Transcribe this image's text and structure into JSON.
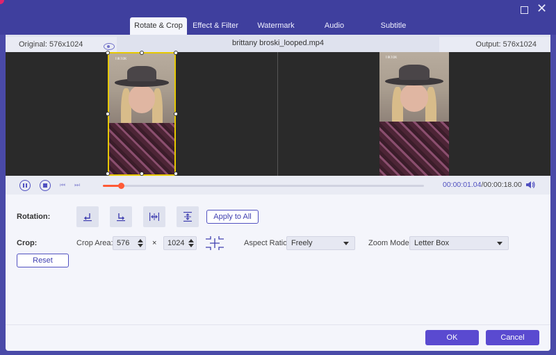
{
  "window": {
    "tabs": [
      {
        "label": "Rotate & Crop",
        "active": true
      },
      {
        "label": "Effect & Filter",
        "active": false
      },
      {
        "label": "Watermark",
        "active": false
      },
      {
        "label": "Audio",
        "active": false
      },
      {
        "label": "Subtitle",
        "active": false
      }
    ],
    "controls": {
      "maximize_icon": "maximize-icon",
      "close_icon": "close-icon"
    }
  },
  "infobar": {
    "original": "Original: 576x1024",
    "filename": "brittany broski_looped.mp4",
    "output": "Output: 576x1024"
  },
  "preview": {
    "watermark_text": "TikTok"
  },
  "playback": {
    "progress": 0.058,
    "current_time": "00:00:01.04",
    "separator": "/",
    "duration": "00:00:18.00",
    "accent_color": "#5050c0",
    "progress_color": "#ff5a36"
  },
  "rotation": {
    "label": "Rotation:",
    "buttons": [
      "rotate-left-icon",
      "rotate-right-icon",
      "flip-horizontal-icon",
      "flip-vertical-icon"
    ],
    "apply_all": "Apply to All"
  },
  "crop": {
    "label": "Crop:",
    "area_label": "Crop Area:",
    "width": "576",
    "times": "×",
    "height": "1024",
    "reset": "Reset",
    "aspect_label": "Aspect Ratio:",
    "aspect_value": "Freely",
    "zoom_label": "Zoom Mode:",
    "zoom_value": "Letter Box"
  },
  "footer": {
    "ok": "OK",
    "cancel": "Cancel",
    "button_color": "#5a4ad0"
  }
}
